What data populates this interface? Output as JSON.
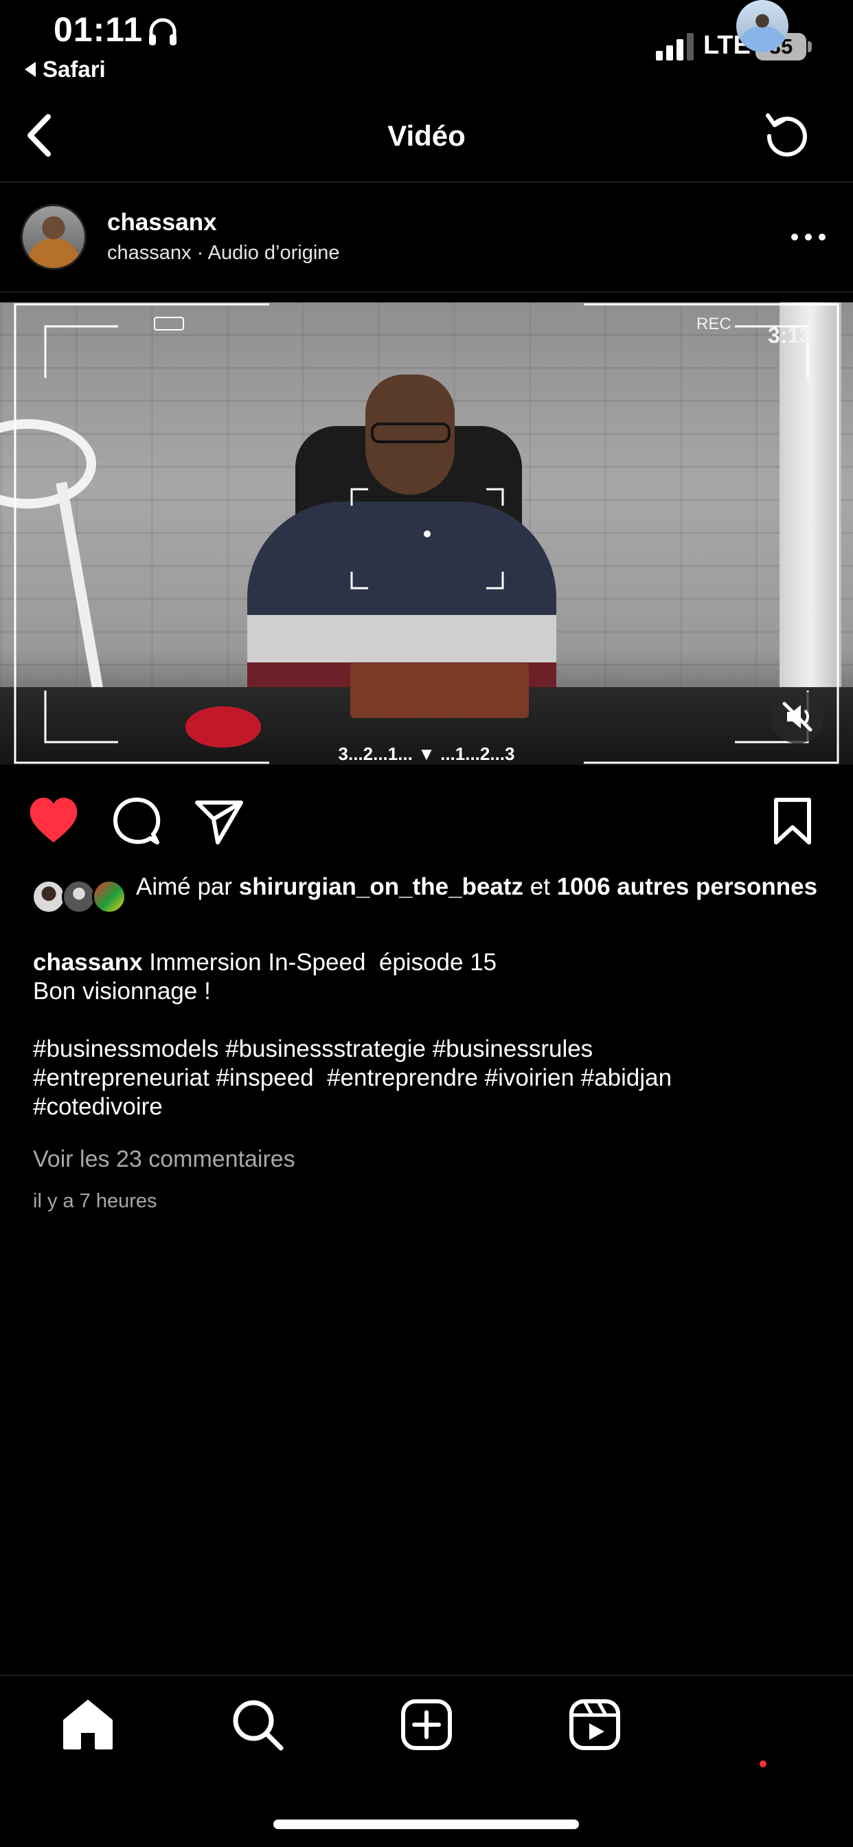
{
  "status_bar": {
    "time": "01:11",
    "back_app": "Safari",
    "network": "LTE",
    "battery": "35"
  },
  "header": {
    "title": "Vidéo"
  },
  "post": {
    "author": "chassanx",
    "subtitle": "chassanx · Audio d’origine",
    "video": {
      "rec_label": "REC",
      "time": "3:13",
      "countdown": "3...2...1... ▼ ...1...2...3"
    },
    "liked": true,
    "likes": {
      "prefix": "Aimé par ",
      "user": "shirurgian_on_the_beatz",
      "middle": " et ",
      "others": "1006 autres personnes"
    },
    "caption": {
      "author": "chassanx",
      "text": " Immersion In-Speed  épisode 15\nBon visionnage !\n\n#businessmodels #businessstrategie #businessrules\n#entrepreneuriat #inspeed  #entreprendre #ivoirien #abidjan\n#cotedivoire"
    },
    "comments_link": "Voir les 23 commentaires",
    "timestamp": "il y a 7 heures"
  },
  "colors": {
    "background": "#000000",
    "like_red": "#ff3040",
    "muted_text": "#a8a8a8"
  },
  "icons": {
    "header_left": "chevron-left-icon",
    "header_right": "refresh-icon",
    "nav": [
      "home-icon",
      "search-icon",
      "create-icon",
      "reels-icon",
      "profile-avatar"
    ]
  }
}
